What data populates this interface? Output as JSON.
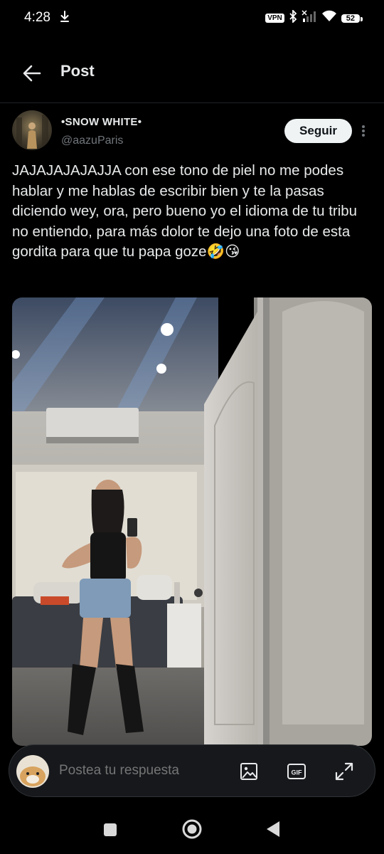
{
  "status_bar": {
    "time": "4:28",
    "vpn": "VPN",
    "battery": "52"
  },
  "header": {
    "title": "Post"
  },
  "post": {
    "author_name": "•SNOW WHITE•",
    "author_handle": "@aazuParis",
    "follow_label": "Seguir",
    "text": "JAJAJAJAJAJJA con ese tono de piel no me podes hablar y me hablas de escribir bien y te la pasas diciendo wey, ora, pero bueno yo el idioma de tu tribu no entiendo, para más dolor te dejo una foto de esta gordita para que tu papa goze🤣😘"
  },
  "reply": {
    "placeholder": "Postea tu respuesta",
    "gif_label": "GIF"
  },
  "colors": {
    "background": "#000000",
    "text_primary": "#e7e9ea",
    "text_secondary": "#71767b",
    "follow_bg": "#eff3f4"
  }
}
